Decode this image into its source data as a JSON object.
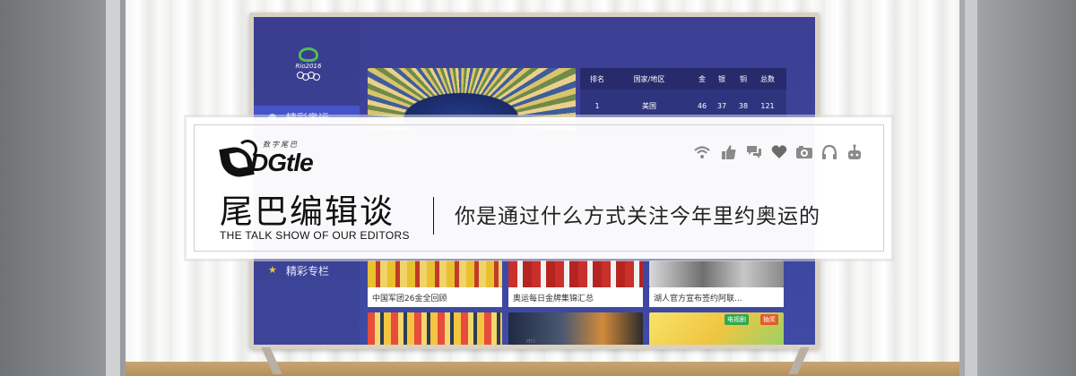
{
  "tv_ui": {
    "logo_text": "Rio2016",
    "sidebar": [
      {
        "label": "精彩奥运",
        "icon": "olympic-rings-icon",
        "active": true
      },
      {
        "label": "精彩专栏",
        "icon": "star-icon",
        "active": false
      }
    ],
    "medal_table": {
      "headers": [
        "排名",
        "国家/地区",
        "金",
        "银",
        "铜",
        "总数"
      ],
      "rows": [
        [
          "1",
          "美国",
          "46",
          "37",
          "38",
          "121"
        ]
      ]
    },
    "tiles": [
      {
        "caption": "中国军团26金全回顾"
      },
      {
        "caption": "奥运每日金牌集锦汇总"
      },
      {
        "caption": "湖人官方宣布签约阿联..."
      }
    ],
    "bottom_tags": [
      "电视剧",
      "抽奖"
    ],
    "tv_brand": "mi"
  },
  "banner": {
    "brand_sub": "数字尾巴",
    "brand_name": "DGtle",
    "show_title": "尾巴编辑谈",
    "show_subtitle": "THE TALK SHOW OF OUR EDITORS",
    "topic": "你是通过什么方式关注今年里约奥运的",
    "icons": [
      "wifi-icon",
      "thumbs-up-icon",
      "chat-icon",
      "heart-icon",
      "camera-icon",
      "headphones-icon",
      "robot-icon"
    ],
    "icon_color": "#8a8a8a",
    "heart_color": "#6b6b6b"
  }
}
